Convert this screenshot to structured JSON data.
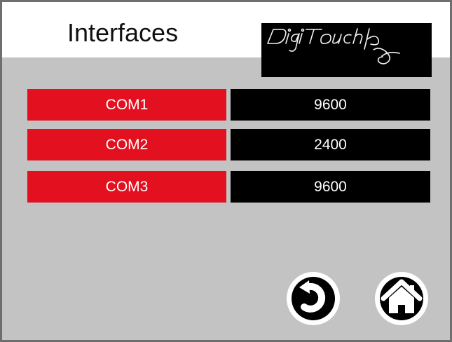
{
  "header": {
    "title": "Interfaces",
    "logo_text": "DigiTouch"
  },
  "interfaces": [
    {
      "label": "COM1",
      "value": "9600"
    },
    {
      "label": "COM2",
      "value": "2400"
    },
    {
      "label": "COM3",
      "value": "9600"
    }
  ],
  "nav": {
    "back_icon": "back-arrow-icon",
    "home_icon": "home-icon"
  },
  "colors": {
    "background": "#c3c3c3",
    "header": "#ffffff",
    "com_label": "#e3101f",
    "com_value": "#000000"
  }
}
